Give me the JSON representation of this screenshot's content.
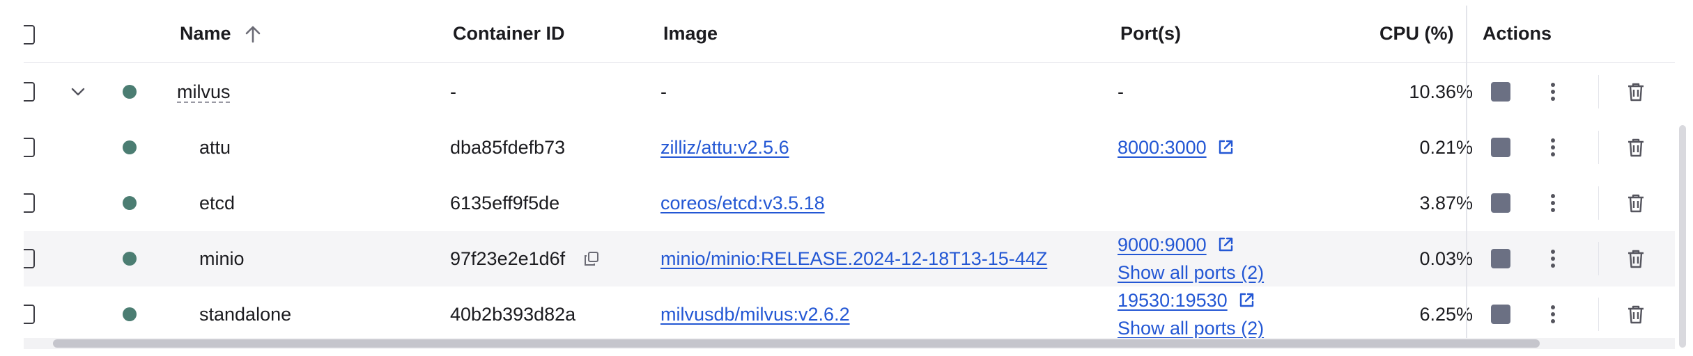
{
  "header": {
    "name": "Name",
    "container_id": "Container ID",
    "image": "Image",
    "ports": "Port(s)",
    "cpu": "CPU (%)",
    "actions": "Actions"
  },
  "rows": [
    {
      "name": "milvus",
      "container_id": "-",
      "image": "-",
      "ports": [
        "-"
      ],
      "cpu": "10.36%",
      "status": "running"
    },
    {
      "name": "attu",
      "container_id": "dba85fdefb73",
      "image": "zilliz/attu:v2.5.6",
      "ports": [
        "8000:3000"
      ],
      "cpu": "0.21%",
      "status": "running"
    },
    {
      "name": "etcd",
      "container_id": "6135eff9f5de",
      "image": "coreos/etcd:v3.5.18",
      "ports": [],
      "cpu": "3.87%",
      "status": "running"
    },
    {
      "name": "minio",
      "container_id": "97f23e2e1d6f",
      "image": "minio/minio:RELEASE.2024-12-18T13-15-44Z",
      "ports": [
        "9000:9000",
        "Show all ports (2)"
      ],
      "cpu": "0.03%",
      "status": "running"
    },
    {
      "name": "standalone",
      "container_id": "40b2b393d82a",
      "image": "milvusdb/milvus:v2.6.2",
      "ports": [
        "19530:19530",
        "Show all ports (2)"
      ],
      "cpu": "6.25%",
      "status": "running"
    }
  ],
  "colors": {
    "running_dot": "#4b7d72",
    "link": "#2357d4",
    "stop_icon": "#6b7083",
    "highlight_row": "#f5f5f7"
  },
  "icons": {
    "sort": "arrow-up-icon",
    "expand": "chevron-down-icon",
    "copy": "copy-icon",
    "external": "external-link-icon",
    "stop": "stop-icon",
    "more": "more-vertical-icon",
    "delete": "trash-icon"
  }
}
